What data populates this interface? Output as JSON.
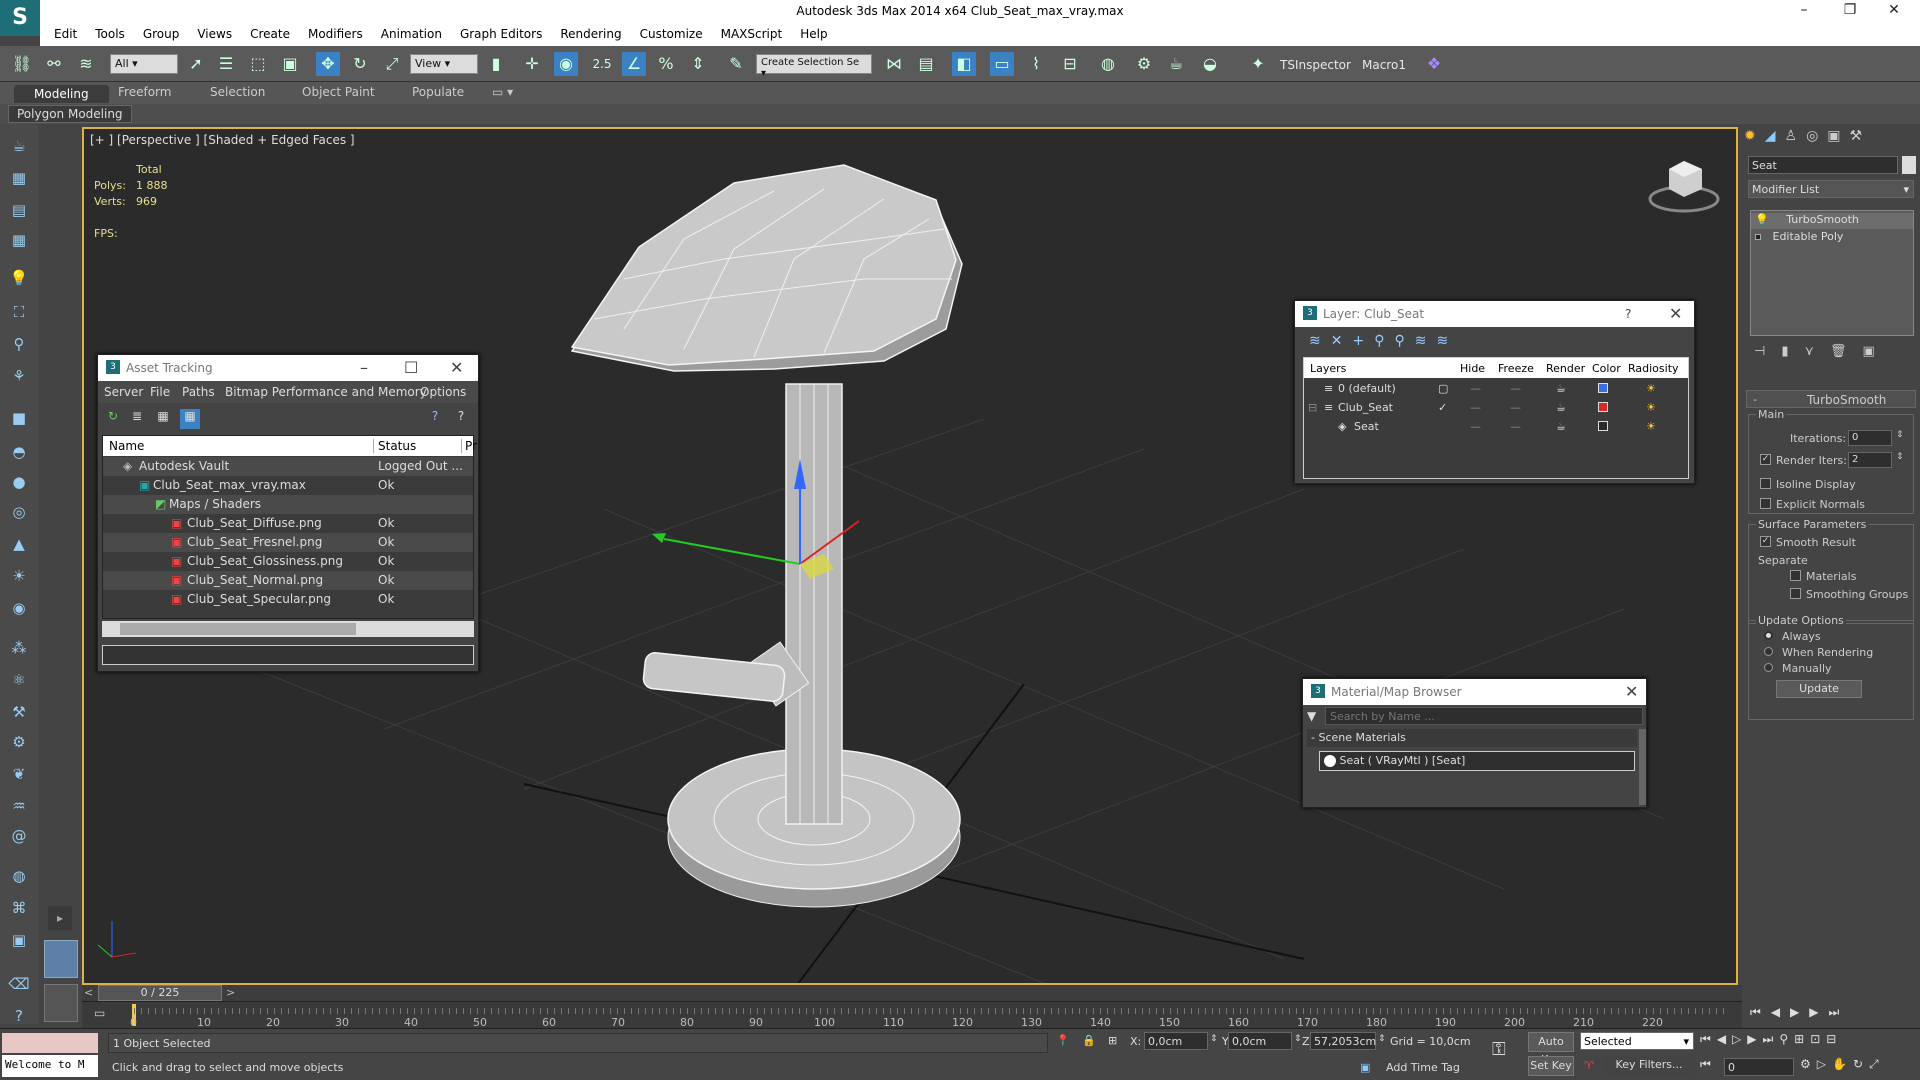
{
  "app": {
    "title": "Autodesk 3ds Max  2014 x64     Club_Seat_max_vray.max",
    "menu": [
      "Edit",
      "Tools",
      "Group",
      "Views",
      "Create",
      "Modifiers",
      "Animation",
      "Graph Editors",
      "Rendering",
      "Customize",
      "MAXScript",
      "Help"
    ]
  },
  "toolbar": {
    "selection_filter": "All",
    "ref_coord": "View",
    "snap_value": "2.5",
    "selection_set": "Create Selection Se",
    "tsinspector": "TSInspector",
    "macro": "Macro1"
  },
  "ribbon": {
    "tabs": [
      "Modeling",
      "Freeform",
      "Selection",
      "Object Paint",
      "Populate"
    ],
    "active_tab": "Modeling",
    "panel": "Polygon Modeling"
  },
  "viewport": {
    "label": "[+ ] [Perspective ] [Shaded + Edged Faces ]",
    "stats_total": "Total",
    "polys_label": "Polys:",
    "polys_value": "1 888",
    "verts_label": "Verts:",
    "verts_value": "969",
    "fps_label": "FPS:"
  },
  "asset_tracking": {
    "title": "Asset Tracking",
    "menu": [
      "Server",
      "File",
      "Paths",
      "Bitmap Performance and Memory",
      "Options"
    ],
    "columns": [
      "Name",
      "Status",
      "Pr"
    ],
    "rows": [
      {
        "name": "Autodesk Vault",
        "status": "Logged Out ..."
      },
      {
        "name": "Club_Seat_max_vray.max",
        "status": "Ok"
      },
      {
        "name": "Maps / Shaders",
        "status": ""
      },
      {
        "name": "Club_Seat_Diffuse.png",
        "status": "Ok"
      },
      {
        "name": "Club_Seat_Fresnel.png",
        "status": "Ok"
      },
      {
        "name": "Club_Seat_Glossiness.png",
        "status": "Ok"
      },
      {
        "name": "Club_Seat_Normal.png",
        "status": "Ok"
      },
      {
        "name": "Club_Seat_Specular.png",
        "status": "Ok"
      }
    ]
  },
  "layer_dialog": {
    "title": "Layer: Club_Seat",
    "help": "?",
    "columns": [
      "Layers",
      "Hide",
      "Freeze",
      "Render",
      "Color",
      "Radiosity"
    ],
    "rows": [
      {
        "name": "0 (default)",
        "color": "#3a6ee0"
      },
      {
        "name": "Club_Seat",
        "color": "#d62a2a"
      },
      {
        "name": "Seat",
        "color": "#2a2a2a"
      }
    ]
  },
  "material_browser": {
    "title": "Material/Map Browser",
    "search_placeholder": "Search by Name ...",
    "section": "- Scene Materials",
    "item": "Seat  ( VRayMtl )  [Seat]"
  },
  "command_panel": {
    "object_name": "Seat",
    "modifier_list": "Modifier List",
    "stack": [
      "TurboSmooth",
      "Editable Poly"
    ],
    "rollout_title": "TurboSmooth",
    "main": "Main",
    "iterations_label": "Iterations:",
    "iterations_value": "0",
    "render_iters_label": "Render Iters:",
    "render_iters_value": "2",
    "isoline": "Isoline Display",
    "explicit": "Explicit Normals",
    "surface": "Surface Parameters",
    "smooth": "Smooth Result",
    "separate": "Separate",
    "materials": "Materials",
    "smoothing": "Smoothing Groups",
    "update_options": "Update Options",
    "always": "Always",
    "when_rendering": "When Rendering",
    "manually": "Manually",
    "update": "Update"
  },
  "timeline": {
    "frame": "0 / 225",
    "ticks": [
      "0",
      "10",
      "20",
      "30",
      "40",
      "50",
      "60",
      "70",
      "80",
      "90",
      "100",
      "110",
      "120",
      "130",
      "140",
      "150",
      "160",
      "170",
      "180",
      "190",
      "200",
      "210",
      "220"
    ]
  },
  "status": {
    "script": "Welcome to M",
    "selected": "1 Object Selected",
    "prompt": "Click and drag to select and move objects",
    "x_label": "X:",
    "x": "0,0cm",
    "y_label": "Y:",
    "y": "0,0cm",
    "z_label": "Z:",
    "z": "57,2053cm",
    "grid": "Grid = 10,0cm",
    "add_time_tag": "Add Time Tag",
    "auto_key": "Auto Key",
    "set_key": "Set Key",
    "key_mode": "Selected",
    "key_filters": "Key Filters...",
    "frame_field": "0"
  }
}
